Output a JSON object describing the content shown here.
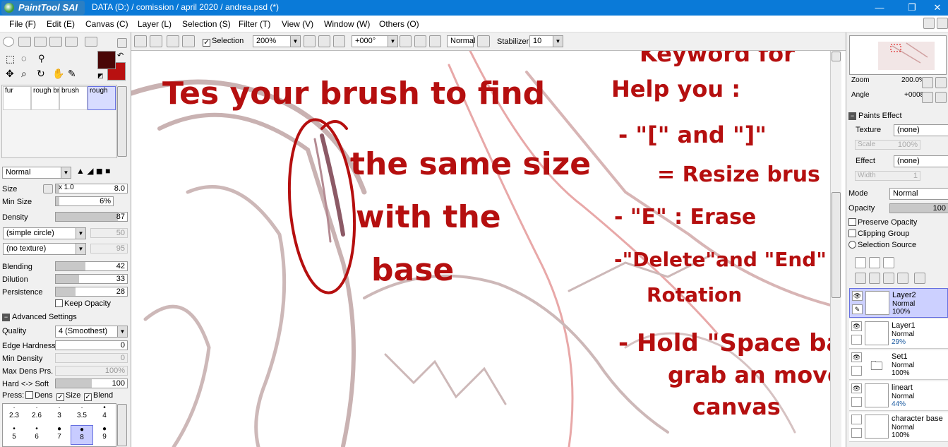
{
  "titlebar": {
    "app_logo": "PaintTool SAI",
    "title": "DATA (D:) / comission / april 2020 / andrea.psd (*)"
  },
  "menu": [
    "File (F)",
    "Edit (E)",
    "Canvas (C)",
    "Layer (L)",
    "Selection (S)",
    "Filter (T)",
    "View (V)",
    "Window (W)",
    "Others (O)"
  ],
  "toolbar": {
    "selection_label": "Selection",
    "zoom": "200%",
    "rotation": "+000°",
    "blend_mode": "Normal",
    "stabilizer_label": "Stabilizer",
    "stabilizer_value": "10"
  },
  "colors": {
    "primary": "#4a0707",
    "secondary": "#b81010",
    "annotation": "#b50f0f"
  },
  "brushes": [
    {
      "label": "fur"
    },
    {
      "label": "rough br"
    },
    {
      "label": "brush"
    },
    {
      "label": "rough"
    }
  ],
  "tool_settings": {
    "blend_mode": "Normal",
    "size_label": "Size",
    "size_multiplier": "x 1.0",
    "size_value": "8.0",
    "min_size_label": "Min Size",
    "min_size_value": "6%",
    "density_label": "Density",
    "density_value": "87",
    "shape": "(simple circle)",
    "shape_value": "50",
    "texture": "(no texture)",
    "texture_value": "95",
    "blending_label": "Blending",
    "blending_value": "42",
    "dilution_label": "Dilution",
    "dilution_value": "33",
    "persistence_label": "Persistence",
    "persistence_value": "28",
    "keep_opacity": "Keep Opacity",
    "advanced": "Advanced Settings",
    "quality_label": "Quality",
    "quality_value": "4 (Smoothest)",
    "edge_hardness_label": "Edge Hardness",
    "edge_hardness_value": "0",
    "min_density_label": "Min Density",
    "min_density_value": "0",
    "max_dens_label": "Max Dens Prs.",
    "max_dens_value": "100%",
    "hard_soft_label": "Hard <-> Soft",
    "hard_soft_value": "100",
    "press_label": "Press:",
    "press_dens": "Dens",
    "press_size": "Size",
    "press_blend": "Blend"
  },
  "brush_sizes": [
    {
      "label": "2.3"
    },
    {
      "label": "2.6"
    },
    {
      "label": "3"
    },
    {
      "label": "3.5"
    },
    {
      "label": "4"
    },
    {
      "label": "5"
    },
    {
      "label": "6"
    },
    {
      "label": "7"
    },
    {
      "label": "8"
    },
    {
      "label": "9"
    }
  ],
  "navigator": {
    "zoom_label": "Zoom",
    "zoom_value": "200.0%",
    "angle_label": "Angle",
    "angle_value": "+0008"
  },
  "paint_effect": {
    "header": "Paints Effect",
    "texture_label": "Texture",
    "texture_value": "(none)",
    "scale_label": "Scale",
    "scale_value": "100%",
    "effect_label": "Effect",
    "effect_value": "(none)",
    "width_label": "Width",
    "width_value": "1"
  },
  "layer_props": {
    "mode_label": "Mode",
    "mode_value": "Normal",
    "opacity_label": "Opacity",
    "opacity_value": "100",
    "preserve_opacity": "Preserve Opacity",
    "clipping_group": "Clipping Group",
    "selection_source": "Selection Source"
  },
  "layers": [
    {
      "name": "Layer2",
      "mode": "Normal",
      "opacity": "100%"
    },
    {
      "name": "Layer1",
      "mode": "Normal",
      "opacity": "29%"
    },
    {
      "name": "Set1",
      "mode": "Normal",
      "opacity": "100%"
    },
    {
      "name": "lineart",
      "mode": "Normal",
      "opacity": "44%"
    },
    {
      "name": "character base",
      "mode": "Normal",
      "opacity": "100%"
    }
  ],
  "annotations": {
    "left": [
      "Tes your brush to find",
      "the same size",
      "with the",
      "base"
    ],
    "right": [
      "Keyword for",
      "Help you :",
      "- \"[\" and \"]\"",
      "= Resize brus",
      "- \"E\" : Erase",
      "-\"Delete\"and \"End\"",
      "Rotation",
      "- Hold \"Space bar\"",
      "grab an move",
      "canvas"
    ]
  }
}
